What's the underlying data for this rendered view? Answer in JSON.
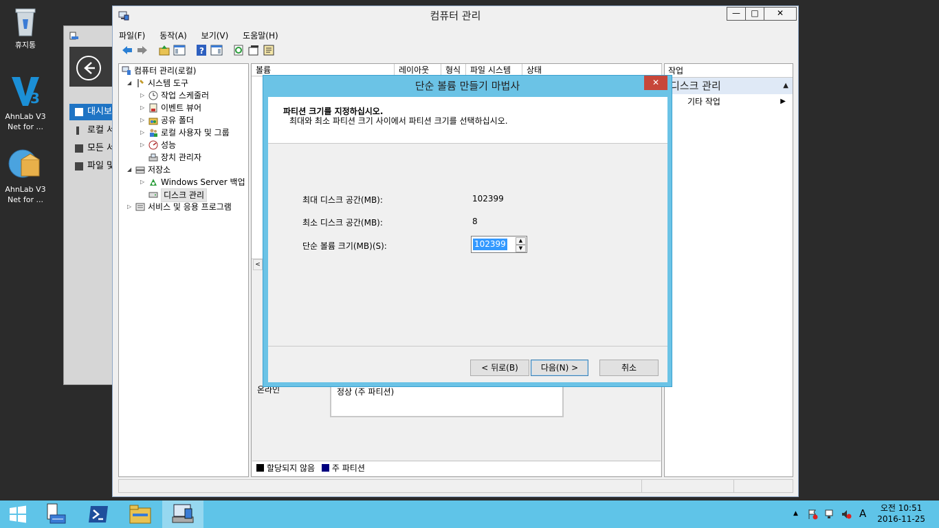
{
  "desktop": {
    "icons": [
      {
        "label": "휴지통",
        "icon": "recycle-bin-icon"
      },
      {
        "label": "AhnLab V3 Net for ...",
        "icon": "ahnlab-v3-icon"
      },
      {
        "label": "AhnLab V3 Net for ...",
        "icon": "ahnlab-v3-update-icon"
      }
    ]
  },
  "server_manager_bg": {
    "nav": [
      "대시보드",
      "로컬 서버",
      "모든 서버",
      "파일 및 저장소 서비스"
    ]
  },
  "window": {
    "title": "컴퓨터 관리",
    "controls": {
      "minimize": "—",
      "maximize": "□",
      "close": "✕"
    },
    "menu": [
      "파일(F)",
      "동작(A)",
      "보기(V)",
      "도움말(H)"
    ]
  },
  "tree": {
    "root": "컴퓨터 관리(로컬)",
    "items": [
      {
        "label": "시스템 도구"
      },
      {
        "label": "작업 스케줄러"
      },
      {
        "label": "이벤트 뷰어"
      },
      {
        "label": "공유 폴더"
      },
      {
        "label": "로컬 사용자 및 그룹"
      },
      {
        "label": "성능"
      },
      {
        "label": "장치 관리자"
      },
      {
        "label": "저장소"
      },
      {
        "label": "Windows Server 백업"
      },
      {
        "label": "디스크 관리"
      },
      {
        "label": "서비스 및 응용 프로그램"
      }
    ]
  },
  "center": {
    "columns": [
      "볼륨",
      "레이아웃",
      "형식",
      "파일 시스템",
      "상태"
    ],
    "partial_row_text": "정상 (주 파티션)",
    "left_partial": [
      "온라인"
    ],
    "legend": [
      {
        "label": "할당되지 않음",
        "color": "#000000"
      },
      {
        "label": "주 파티션",
        "color": "#00007f"
      }
    ]
  },
  "actions": {
    "header": "작업",
    "selected": "디스크 관리",
    "more": "기타 작업"
  },
  "wizard": {
    "title": "단순 볼륨 만들기 마법사",
    "close": "✕",
    "heading": "파티션 크기를 지정하십시오.",
    "subheading": "최대와 최소 파티션 크기 사이에서 파티션 크기를 선택하십시오.",
    "max_label": "최대 디스크 공간(MB):",
    "max_value": "102399",
    "min_label": "최소 디스크 공간(MB):",
    "min_value": "8",
    "size_label": "단순 볼륨 크기(MB)(S):",
    "size_value": "102399",
    "buttons": {
      "back": "< 뒤로(B)",
      "next": "다음(N) >",
      "cancel": "취소"
    }
  },
  "taskbar": {
    "clock_time": "오전 10:51",
    "clock_date": "2016-11-25",
    "ime": "A"
  }
}
